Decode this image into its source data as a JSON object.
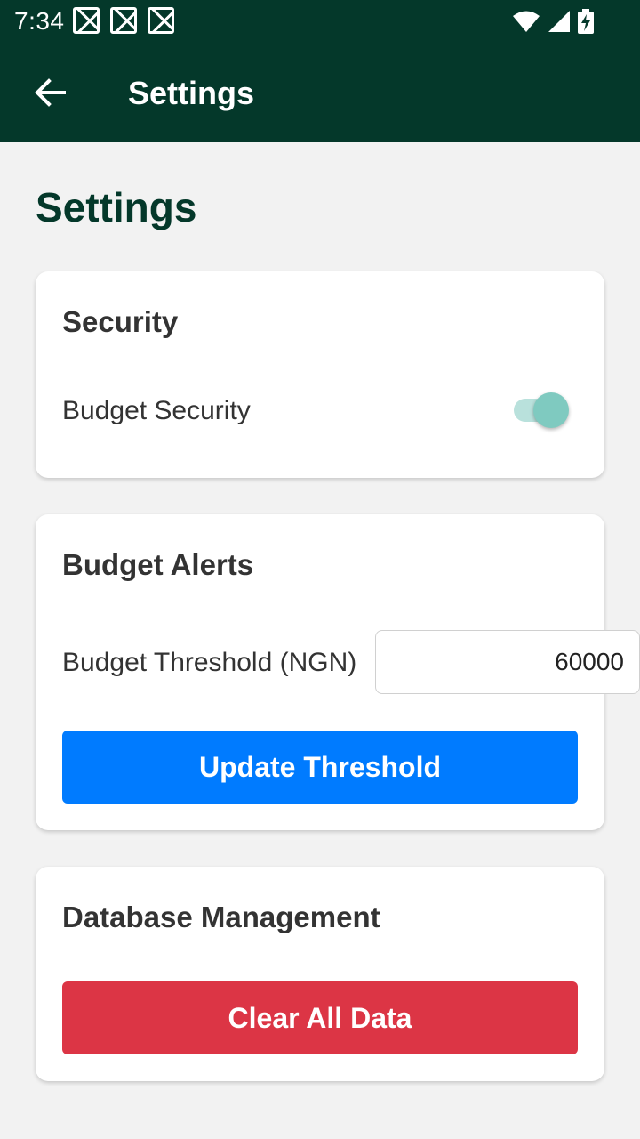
{
  "status_bar": {
    "time": "7:34",
    "icons": [
      "notification-icon",
      "notification-icon",
      "notification-icon",
      "wifi-icon",
      "signal-icon",
      "battery-charging-icon"
    ]
  },
  "toolbar": {
    "title": "Settings",
    "back_icon": "arrow-left-icon"
  },
  "page": {
    "title": "Settings"
  },
  "security": {
    "title": "Security",
    "budget_security_label": "Budget Security",
    "budget_security_enabled": true
  },
  "budget_alerts": {
    "title": "Budget Alerts",
    "threshold_label": "Budget Threshold (NGN)",
    "threshold_value": "60000",
    "update_button": "Update Threshold"
  },
  "database": {
    "title": "Database Management",
    "clear_button": "Clear All Data"
  },
  "colors": {
    "header": "#04382a",
    "primary_button": "#007bff",
    "danger_button": "#dc3545",
    "toggle_thumb": "#7fcac0"
  }
}
